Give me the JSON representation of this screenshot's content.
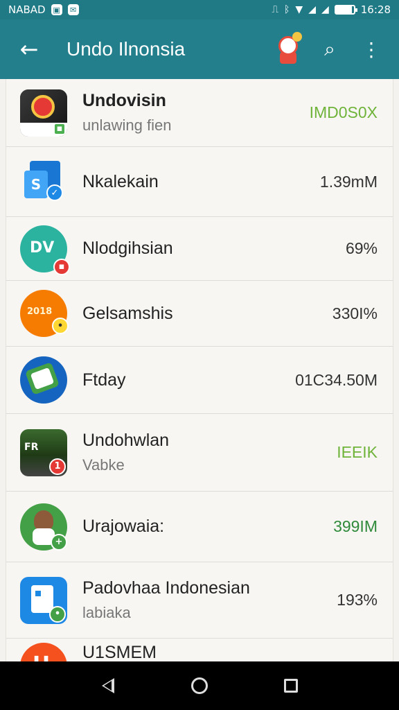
{
  "status_bar": {
    "carrier": "NABAD",
    "time": "16:28"
  },
  "app_bar": {
    "title": "Undo Ilnonsia"
  },
  "items": [
    {
      "title": "Undovisin",
      "subtitle": "unlawing fien",
      "value": "IMD0S0X",
      "value_color": "#6fb33a"
    },
    {
      "title": "Nkalekain",
      "subtitle": "",
      "value": "1.39mM",
      "value_color": "#333333"
    },
    {
      "title": "Nlodgihsian",
      "subtitle": "",
      "value": "69%",
      "value_color": "#333333"
    },
    {
      "title": "Gelsamshis",
      "subtitle": "",
      "value": "330I%",
      "value_color": "#333333"
    },
    {
      "title": "Ftday",
      "subtitle": "",
      "value": "01C34.50M",
      "value_color": "#333333"
    },
    {
      "title": "Undohwlan",
      "subtitle": "Vabke",
      "value": "IEEIK",
      "value_color": "#6fb33a"
    },
    {
      "title": "Urajowaia:",
      "subtitle": "",
      "value": "399IM",
      "value_color": "#2f8a3a"
    },
    {
      "title": "Padovhaa Indonesian",
      "subtitle": "labiaka",
      "value": "193%",
      "value_color": "#333333"
    },
    {
      "title": "U1SMEM",
      "subtitle": "",
      "value": "",
      "value_color": "#6fb33a"
    }
  ],
  "icons": {
    "item0": "red-seal-app-icon",
    "item1": "blue-document-app-icon",
    "item2": "teal-dv-app-icon",
    "item3": "orange-fruit-app-icon",
    "item4": "blue-round-app-icon",
    "item5": "forest-landscape-app-icon",
    "item6": "green-animal-app-icon",
    "item7": "blue-robot-app-icon",
    "item8": "red-h-app-icon"
  }
}
